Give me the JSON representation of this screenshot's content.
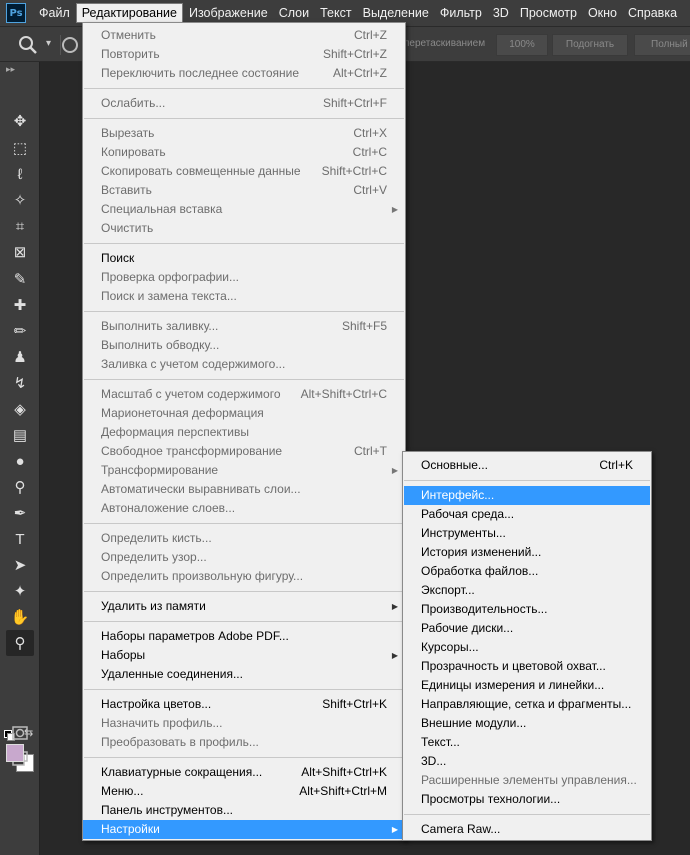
{
  "app": {
    "logo": "Ps"
  },
  "menubar": {
    "items": [
      "Файл",
      "Редактирование",
      "Изображение",
      "Слои",
      "Текст",
      "Выделение",
      "Фильтр",
      "3D",
      "Просмотр",
      "Окно",
      "Справка"
    ],
    "active": "Редактирование"
  },
  "options": {
    "drag_label": "перетаскиванием",
    "btn_100": "100%",
    "btn_fit": "Подогнать",
    "btn_fill": "Полный"
  },
  "edit_menu": {
    "groups": [
      [
        {
          "label": "Отменить",
          "shortcut": "Ctrl+Z",
          "disabled": true
        },
        {
          "label": "Повторить",
          "shortcut": "Shift+Ctrl+Z",
          "disabled": true
        },
        {
          "label": "Переключить последнее состояние",
          "shortcut": "Alt+Ctrl+Z",
          "disabled": true
        }
      ],
      [
        {
          "label": "Ослабить...",
          "shortcut": "Shift+Ctrl+F",
          "disabled": true
        }
      ],
      [
        {
          "label": "Вырезать",
          "shortcut": "Ctrl+X",
          "disabled": true
        },
        {
          "label": "Копировать",
          "shortcut": "Ctrl+C",
          "disabled": true
        },
        {
          "label": "Скопировать совмещенные данные",
          "shortcut": "Shift+Ctrl+C",
          "disabled": true
        },
        {
          "label": "Вставить",
          "shortcut": "Ctrl+V",
          "disabled": true
        },
        {
          "label": "Специальная вставка",
          "shortcut": "",
          "disabled": true,
          "submenu": true
        },
        {
          "label": "Очистить",
          "shortcut": "",
          "disabled": true
        }
      ],
      [
        {
          "label": "Поиск",
          "shortcut": "",
          "disabled": false
        },
        {
          "label": "Проверка орфографии...",
          "shortcut": "",
          "disabled": true
        },
        {
          "label": "Поиск и замена текста...",
          "shortcut": "",
          "disabled": true
        }
      ],
      [
        {
          "label": "Выполнить заливку...",
          "shortcut": "Shift+F5",
          "disabled": true
        },
        {
          "label": "Выполнить обводку...",
          "shortcut": "",
          "disabled": true
        },
        {
          "label": "Заливка с учетом содержимого...",
          "shortcut": "",
          "disabled": true
        }
      ],
      [
        {
          "label": "Масштаб с учетом содержимого",
          "shortcut": "Alt+Shift+Ctrl+C",
          "disabled": true
        },
        {
          "label": "Марионеточная деформация",
          "shortcut": "",
          "disabled": true
        },
        {
          "label": "Деформация перспективы",
          "shortcut": "",
          "disabled": true
        },
        {
          "label": "Свободное трансформирование",
          "shortcut": "Ctrl+T",
          "disabled": true
        },
        {
          "label": "Трансформирование",
          "shortcut": "",
          "disabled": true,
          "submenu": true
        },
        {
          "label": "Автоматически выравнивать слои...",
          "shortcut": "",
          "disabled": true
        },
        {
          "label": "Автоналожение слоев...",
          "shortcut": "",
          "disabled": true
        }
      ],
      [
        {
          "label": "Определить кисть...",
          "shortcut": "",
          "disabled": true
        },
        {
          "label": "Определить узор...",
          "shortcut": "",
          "disabled": true
        },
        {
          "label": "Определить произвольную фигуру...",
          "shortcut": "",
          "disabled": true
        }
      ],
      [
        {
          "label": "Удалить из памяти",
          "shortcut": "",
          "disabled": false,
          "submenu": true
        }
      ],
      [
        {
          "label": "Наборы параметров Adobe PDF...",
          "shortcut": "",
          "disabled": false
        },
        {
          "label": "Наборы",
          "shortcut": "",
          "disabled": false,
          "submenu": true
        },
        {
          "label": "Удаленные соединения...",
          "shortcut": "",
          "disabled": false
        }
      ],
      [
        {
          "label": "Настройка цветов...",
          "shortcut": "Shift+Ctrl+K",
          "disabled": false
        },
        {
          "label": "Назначить профиль...",
          "shortcut": "",
          "disabled": true
        },
        {
          "label": "Преобразовать в профиль...",
          "shortcut": "",
          "disabled": true
        }
      ],
      [
        {
          "label": "Клавиатурные сокращения...",
          "shortcut": "Alt+Shift+Ctrl+K",
          "disabled": false
        },
        {
          "label": "Меню...",
          "shortcut": "Alt+Shift+Ctrl+M",
          "disabled": false
        },
        {
          "label": "Панель инструментов...",
          "shortcut": "",
          "disabled": false
        },
        {
          "label": "Настройки",
          "shortcut": "",
          "disabled": false,
          "submenu": true,
          "highlight": true
        }
      ]
    ]
  },
  "settings_submenu": {
    "groups": [
      [
        {
          "label": "Основные...",
          "shortcut": "Ctrl+K",
          "disabled": false
        }
      ],
      [
        {
          "label": "Интерфейс...",
          "shortcut": "",
          "disabled": false,
          "highlight": true
        },
        {
          "label": "Рабочая среда...",
          "shortcut": "",
          "disabled": false
        },
        {
          "label": "Инструменты...",
          "shortcut": "",
          "disabled": false
        },
        {
          "label": "История изменений...",
          "shortcut": "",
          "disabled": false
        },
        {
          "label": "Обработка файлов...",
          "shortcut": "",
          "disabled": false
        },
        {
          "label": "Экспорт...",
          "shortcut": "",
          "disabled": false
        },
        {
          "label": "Производительность...",
          "shortcut": "",
          "disabled": false
        },
        {
          "label": "Рабочие диски...",
          "shortcut": "",
          "disabled": false
        },
        {
          "label": "Курсоры...",
          "shortcut": "",
          "disabled": false
        },
        {
          "label": "Прозрачность и цветовой охват...",
          "shortcut": "",
          "disabled": false
        },
        {
          "label": "Единицы измерения и линейки...",
          "shortcut": "",
          "disabled": false
        },
        {
          "label": "Направляющие, сетка и фрагменты...",
          "shortcut": "",
          "disabled": false
        },
        {
          "label": "Внешние модули...",
          "shortcut": "",
          "disabled": false
        },
        {
          "label": "Текст...",
          "shortcut": "",
          "disabled": false
        },
        {
          "label": "3D...",
          "shortcut": "",
          "disabled": false
        },
        {
          "label": "Расширенные элементы управления...",
          "shortcut": "",
          "disabled": true
        },
        {
          "label": "Просмотры технологии...",
          "shortcut": "",
          "disabled": false
        }
      ],
      [
        {
          "label": "Camera Raw...",
          "shortcut": "",
          "disabled": false
        }
      ]
    ]
  },
  "swatches": {
    "foreground": "#c8a8cd",
    "background": "#ffffff"
  },
  "tools": [
    {
      "name": "move-tool-icon",
      "glyph": "✥"
    },
    {
      "name": "marquee-tool-icon",
      "glyph": "⬚"
    },
    {
      "name": "lasso-tool-icon",
      "glyph": "ℓ"
    },
    {
      "name": "magic-wand-tool-icon",
      "glyph": "✧"
    },
    {
      "name": "crop-tool-icon",
      "glyph": "⌗"
    },
    {
      "name": "frame-tool-icon",
      "glyph": "⊠"
    },
    {
      "name": "eyedropper-tool-icon",
      "glyph": "✎"
    },
    {
      "name": "healing-brush-tool-icon",
      "glyph": "✚"
    },
    {
      "name": "brush-tool-icon",
      "glyph": "✏"
    },
    {
      "name": "clone-stamp-tool-icon",
      "glyph": "♟"
    },
    {
      "name": "history-brush-tool-icon",
      "glyph": "↯"
    },
    {
      "name": "eraser-tool-icon",
      "glyph": "◈"
    },
    {
      "name": "gradient-tool-icon",
      "glyph": "▤"
    },
    {
      "name": "blur-tool-icon",
      "glyph": "●"
    },
    {
      "name": "dodge-tool-icon",
      "glyph": "⚲"
    },
    {
      "name": "pen-tool-icon",
      "glyph": "✒"
    },
    {
      "name": "type-tool-icon",
      "glyph": "T"
    },
    {
      "name": "path-selection-tool-icon",
      "glyph": "➤"
    },
    {
      "name": "shape-tool-icon",
      "glyph": "✦"
    },
    {
      "name": "hand-tool-icon",
      "glyph": "✋"
    },
    {
      "name": "zoom-tool-icon",
      "glyph": "⚲",
      "selected": true
    },
    {
      "name": "more-tools-icon",
      "glyph": "•••"
    }
  ]
}
